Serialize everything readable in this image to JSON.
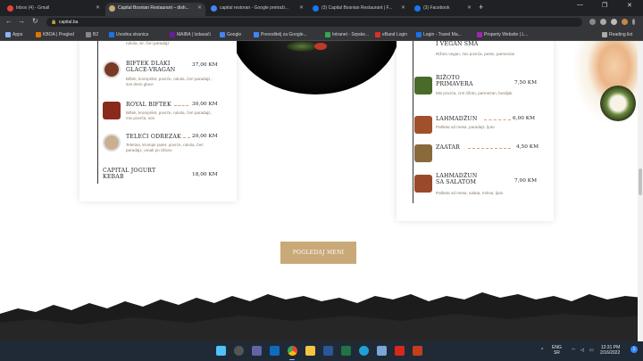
{
  "browser": {
    "tabs": [
      {
        "label": "Inbox (4) - Gmail",
        "favicon_color": "#ea4335"
      },
      {
        "label": "Capital Bosnian Restaurant – dish...",
        "favicon_color": "#c9a978"
      },
      {
        "label": "capital restoran - Google pretraži...",
        "favicon_color": "#4285f4"
      },
      {
        "label": "(3) Capital Bosnian Restaurant | F...",
        "favicon_color": "#1877f2"
      },
      {
        "label": "(3) Facebook",
        "favicon_color": "#1877f2"
      }
    ],
    "address": "capital.ba",
    "bookmarks": [
      {
        "label": "Apps",
        "color": "#8ab4f8"
      },
      {
        "label": "KBOA | Pregled",
        "color": "#e37400"
      },
      {
        "label": "B2",
        "color": "#888"
      },
      {
        "label": "Uvodna stranica",
        "color": "#1a73e8"
      },
      {
        "label": "MAIBA | Izdavači",
        "color": "#6a1b9a"
      },
      {
        "label": "Google",
        "color": "#4285f4"
      },
      {
        "label": "Prevoditelj za Google...",
        "color": "#4285f4"
      },
      {
        "label": "Intranet - Srpske...",
        "color": "#34a853"
      },
      {
        "label": "eBand Login",
        "color": "#d93025"
      },
      {
        "label": "Login - Travel Ma...",
        "color": "#1a73e8"
      },
      {
        "label": "Property Website | L...",
        "color": "#9c27b0"
      },
      {
        "label": "Reading list",
        "color": "#aaa"
      }
    ]
  },
  "menu_left": [
    {
      "name": "",
      "desc": "rukola, sir, čeri paradajz",
      "price": "",
      "thumb": "#5a4a2a",
      "round": false
    },
    {
      "name": "BIFTEK DLAKI GLACE-VRAGAN",
      "desc": "Biftek, kromprilet, povrće, rukola, čeri paradajz, sos demi glace",
      "price": "37,00 KM",
      "thumb": "#7a3a24",
      "round": true
    },
    {
      "name": "ROYAL BIFTEK",
      "desc": "Biftek, kromprilet, povrće, rukola, čeri paradajz, mix povrća, sos",
      "price": "30,00 KM",
      "thumb": "#8a2a1a",
      "round": false
    },
    {
      "name": "TELEĆI ODREZAK",
      "desc": "Teletina, krompir puter, povrće, rukola, čeri paradajz, umak po izboru",
      "price": "20,00 KM",
      "thumb": "#c9b090",
      "round": true
    },
    {
      "name": "CAPITAL JOGURT KEBAB",
      "desc": "",
      "price": "18,00 KM",
      "thumb": "",
      "round": false
    }
  ],
  "menu_right": [
    {
      "name": "I VEGAN SMA",
      "desc": "Rižoto vegan, mix povrća, pesto, parmezan",
      "price": "",
      "thumb": "",
      "round": false
    },
    {
      "name": "RIŽOTO PRIMAVERA",
      "desc": "Mix povrća, crni rižoto, parmezan, bosiljak",
      "price": "7,50 KM",
      "thumb": "#4a6a2a",
      "round": false
    },
    {
      "name": "LAHMADŽUN",
      "desc": "Pašteta od mesa, paradajz, ljuto",
      "price": "6,00 KM",
      "thumb": "#a0502a",
      "round": false
    },
    {
      "name": "ZAATAR",
      "desc": "",
      "price": "4,50 KM",
      "thumb": "#8a6a3a",
      "round": false
    },
    {
      "name": "LAHMADŽUN SA SALATOM",
      "desc": "Pašteta od mesa, salata, mrkva, ljuto",
      "price": "7,00 KM",
      "thumb": "#9a4a2a",
      "round": false
    }
  ],
  "cta_button": "POGLEDAJ MENI",
  "taskbar": {
    "lang": "ENG",
    "lang_sub": "SR",
    "time": "12:31 PM",
    "date": "2/16/2022"
  },
  "colors": {
    "accent": "#c9a978",
    "dark_band": "#1c1c1c"
  }
}
